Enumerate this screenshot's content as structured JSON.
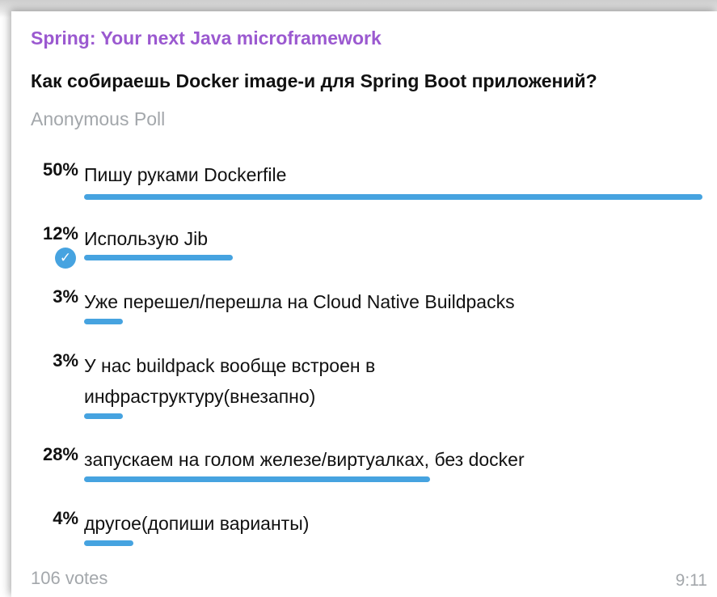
{
  "poll": {
    "channel": "Spring: Your next Java microframework",
    "question": "Как собираешь Docker image-и для Spring Boot приложений?",
    "type": "Anonymous Poll",
    "options": [
      {
        "percent": "50%",
        "text": "Пишу руками Dockerfile",
        "share": 50,
        "chosen": false
      },
      {
        "percent": "12%",
        "text": "Использую Jib",
        "share": 12,
        "chosen": true
      },
      {
        "percent": "3%",
        "text": "Уже перешел/перешла на Cloud Native Buildpacks",
        "share": 3,
        "chosen": false
      },
      {
        "percent": "3%",
        "text": "У нас buildpack вообще встроен в инфраструктуру(внезапно)",
        "share": 3,
        "chosen": false
      },
      {
        "percent": "28%",
        "text": "запускаем на голом железе/виртуалках, без docker",
        "share": 28,
        "chosen": false
      },
      {
        "percent": "4%",
        "text": "другое(допиши варианты)",
        "share": 4,
        "chosen": false
      }
    ],
    "votes": "106 votes",
    "time": "9:11",
    "chosen_icon": "check-circle-icon",
    "bar_color": "#46a3e0",
    "channel_color": "#9b59d0"
  }
}
